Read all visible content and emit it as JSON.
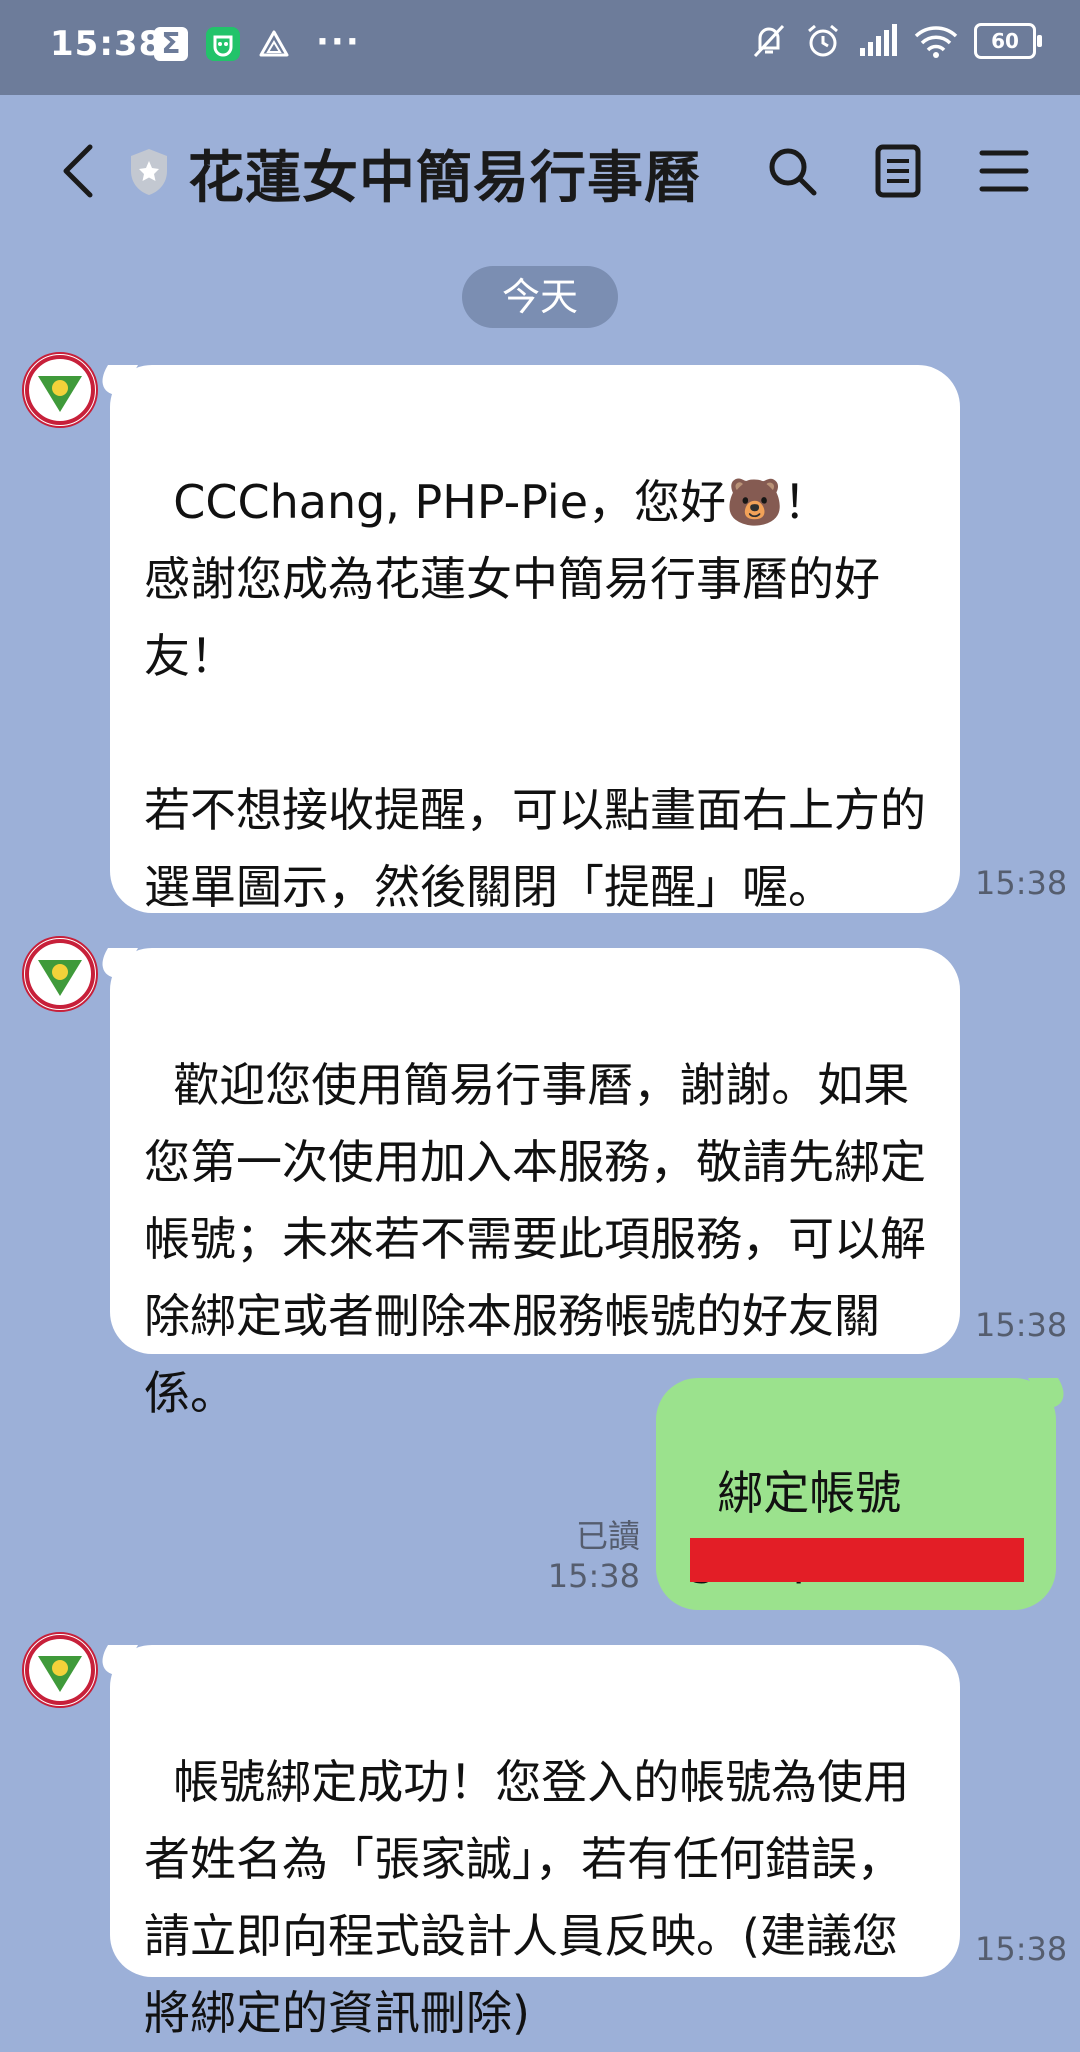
{
  "status_bar": {
    "time": "15:38",
    "sigma_glyph": "Σ",
    "more_dots": "···",
    "battery_level": "60",
    "icons": [
      "sigma-app-icon",
      "green-app-icon",
      "triangle-app-icon",
      "mute-icon",
      "alarm-icon",
      "signal-icon",
      "wifi-icon",
      "battery-icon"
    ]
  },
  "header": {
    "title": "花蓮女中簡易行事曆",
    "icons": [
      "back-icon",
      "verified-shield-icon",
      "search-icon",
      "notes-icon",
      "menu-icon"
    ]
  },
  "chat": {
    "date_divider": "今天",
    "messages": [
      {
        "sender": "bot",
        "text": "CCChang, PHP-Pie，您好🐻！\n感謝您成為花蓮女中簡易行事曆的好友！\n\n若不想接收提醒，可以點畫面右上方的選單圖示，然後關閉「提醒」喔。",
        "time": "15:38"
      },
      {
        "sender": "bot",
        "text": "歡迎您使用簡易行事曆，謝謝。如果您第一次使用加入本服務，敬請先綁定帳號；未來若不需要此項服務，可以解除綁定或者刪除本服務帳號的好友關係。",
        "time": "15:38"
      },
      {
        "sender": "me",
        "text": "綁定帳號\ngroup03",
        "read_label": "已讀",
        "time": "15:38"
      },
      {
        "sender": "bot",
        "text": "帳號綁定成功！您登入的帳號為使用者姓名為「張家誠」，若有任何錯誤，請立即向程式設計人員反映。(建議您將綁定的資訊刪除)",
        "time": "15:38"
      }
    ]
  },
  "colors": {
    "background": "#9cb0d8",
    "status_bar": "#6d7c9a",
    "my_bubble": "#9be28d",
    "bot_bubble": "#ffffff",
    "redaction": "#e31e26"
  }
}
